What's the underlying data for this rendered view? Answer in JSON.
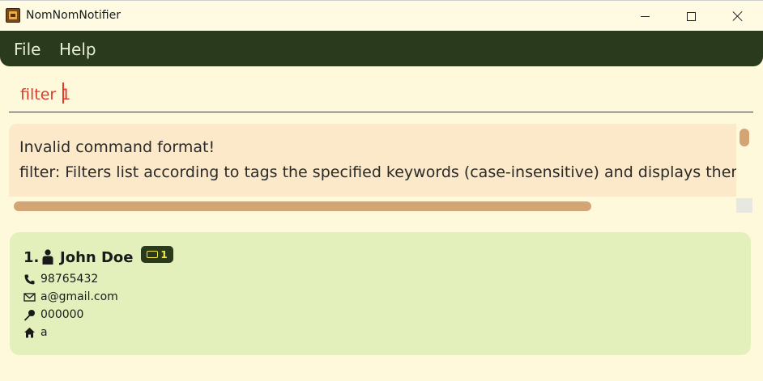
{
  "window": {
    "title": "NomNomNotifier"
  },
  "menu": {
    "items": [
      "File",
      "Help"
    ]
  },
  "command_box": {
    "value": "filter 1"
  },
  "result_display": {
    "lines": [
      "Invalid command format!",
      "filter: Filters list according to tags the specified keywords (case-insensitive) and displays them as a l"
    ]
  },
  "persons": [
    {
      "index": "1.",
      "name": "John Doe",
      "tag_count": "1",
      "phone": "98765432",
      "email": "a@gmail.com",
      "postal": "000000",
      "address": "a"
    }
  ],
  "colors": {
    "accent": "#2a3a1c",
    "background": "#fff9dc",
    "error_text": "#e23a2a",
    "card": "#e3f0bc",
    "result_panel": "#fbe9c9",
    "scrollbar": "#d4a574",
    "tag_text": "#f2e84a"
  }
}
